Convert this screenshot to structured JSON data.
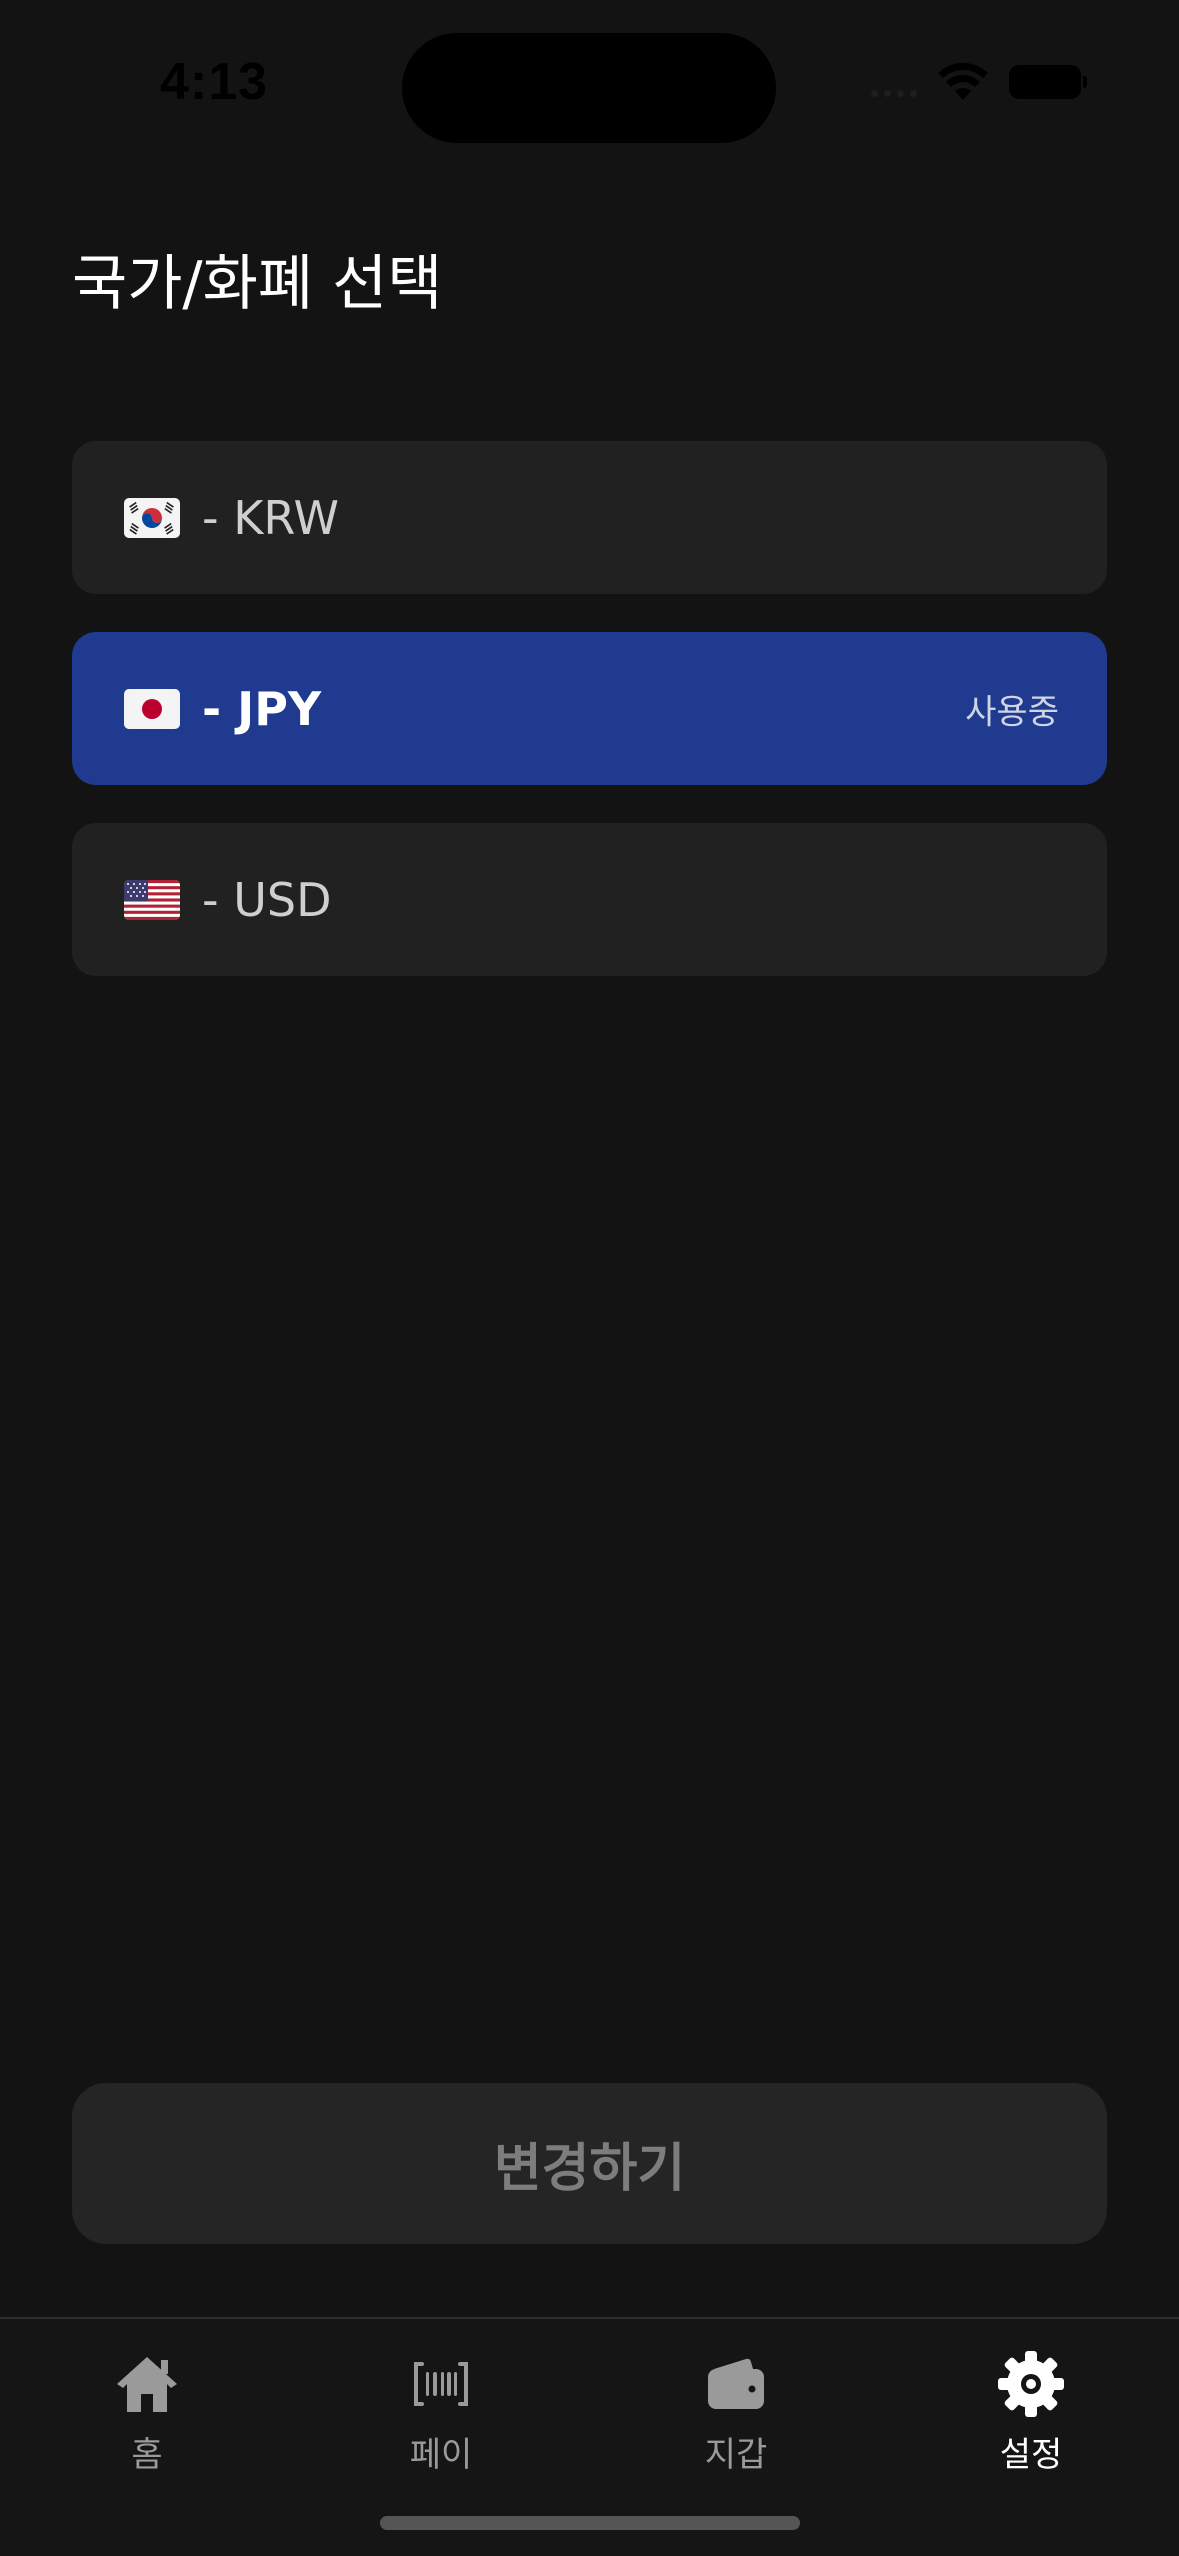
{
  "status_bar": {
    "time": "4:13"
  },
  "page": {
    "title": "국가/화폐 선택"
  },
  "currencies": [
    {
      "flag_icon": "korea-flag-icon",
      "label": "- KRW",
      "selected": false,
      "badge": ""
    },
    {
      "flag_icon": "japan-flag-icon",
      "label": "- JPY",
      "selected": true,
      "badge": "사용중"
    },
    {
      "flag_icon": "usa-flag-icon",
      "label": "- USD",
      "selected": false,
      "badge": ""
    }
  ],
  "change_button": {
    "label": "변경하기"
  },
  "tab_bar": {
    "tabs": [
      {
        "icon": "home-icon",
        "label": "홈",
        "active": false
      },
      {
        "icon": "barcode-icon",
        "label": "페이",
        "active": false
      },
      {
        "icon": "wallet-icon",
        "label": "지갑",
        "active": false
      },
      {
        "icon": "gear-icon",
        "label": "설정",
        "active": true
      }
    ]
  },
  "colors": {
    "background": "#131313",
    "card": "#212121",
    "selected_card": "#1f3a8e",
    "button": "#252525",
    "button_text": "#7d7d7d",
    "inactive_tab": "#9a9a9a",
    "active_tab": "#ffffff"
  }
}
